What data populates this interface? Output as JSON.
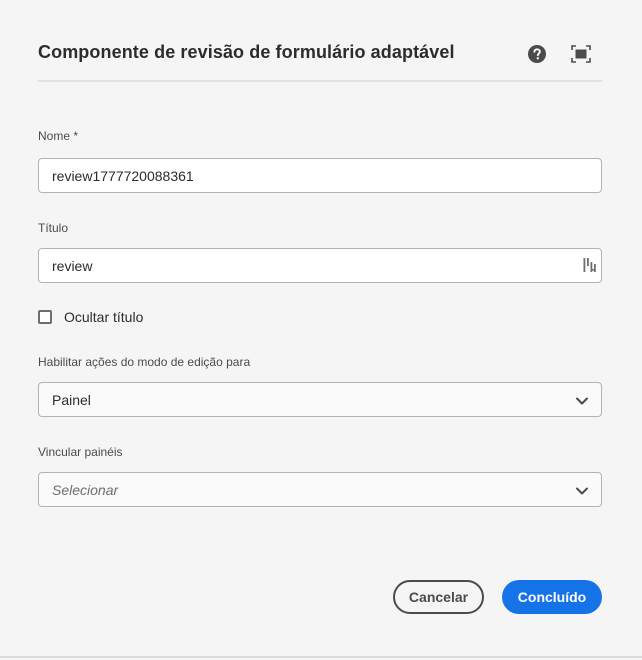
{
  "dialog": {
    "title": "Componente de revisão de formulário adaptável"
  },
  "icons": {
    "help": "help-icon",
    "fullscreen": "fullscreen-icon",
    "translate": "i18n-icon",
    "chevron": "chevron-down-icon"
  },
  "fields": {
    "name": {
      "label": "Nome *",
      "value": "review1777720088361"
    },
    "title": {
      "label": "Título",
      "value": "review"
    },
    "hide_title": {
      "label": "Ocultar título",
      "checked": false
    },
    "edit_mode": {
      "label": "Habilitar ações do modo de edição para",
      "value": "Painel"
    },
    "link_panels": {
      "label": "Vincular painéis",
      "placeholder": "Selecionar"
    }
  },
  "buttons": {
    "cancel": "Cancelar",
    "done": "Concluído"
  },
  "colors": {
    "accent": "#1473e6",
    "background": "#f5f5f5"
  }
}
